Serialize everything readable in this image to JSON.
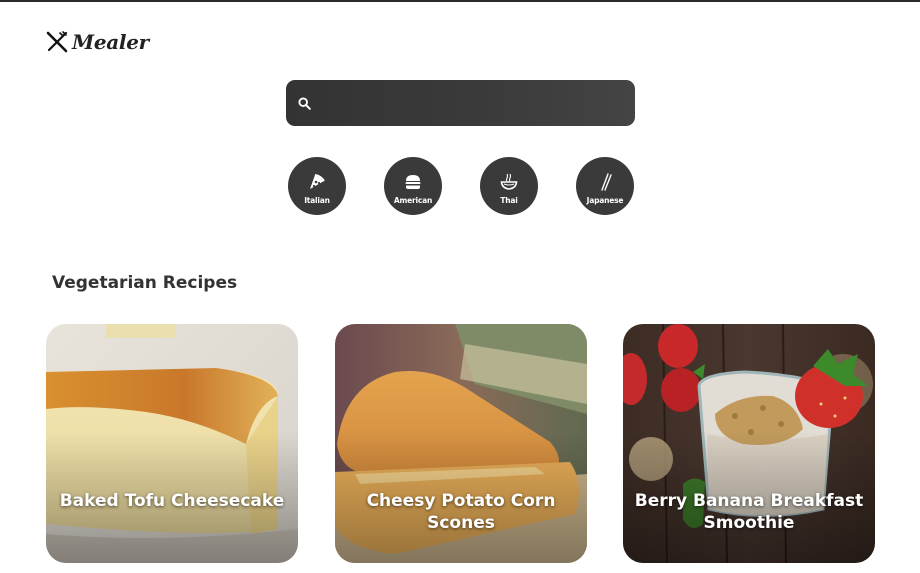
{
  "brand": {
    "name": "Mealer",
    "icon": "fork-knife-icon"
  },
  "search": {
    "placeholder": "",
    "value": "",
    "icon": "search-icon"
  },
  "cuisines": [
    {
      "label": "Italian",
      "icon": "pizza-icon"
    },
    {
      "label": "American",
      "icon": "burger-icon"
    },
    {
      "label": "Thai",
      "icon": "noodle-bowl-icon"
    },
    {
      "label": "Japanese",
      "icon": "chopsticks-icon"
    }
  ],
  "section": {
    "title": "Vegetarian Recipes"
  },
  "recipes": [
    {
      "title": "Baked Tofu Cheesecake"
    },
    {
      "title": "Cheesy Potato Corn Scones"
    },
    {
      "title": "Berry Banana Breakfast Smoothie"
    }
  ],
  "colors": {
    "dark": "#3a3a3a",
    "search_bg": "#383838",
    "text": "#333333"
  }
}
